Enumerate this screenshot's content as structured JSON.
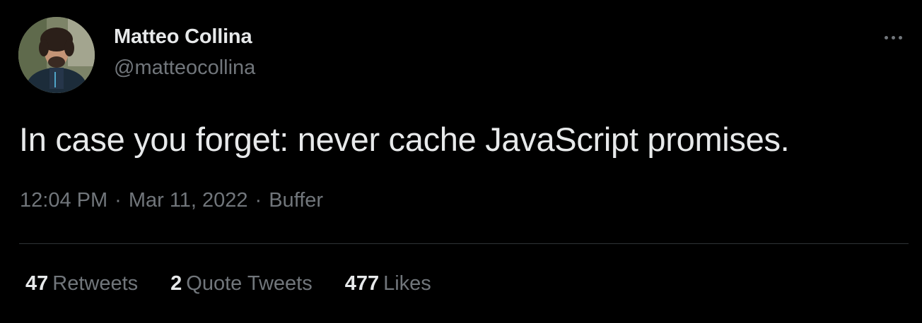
{
  "author": {
    "display_name": "Matteo Collina",
    "handle": "@matteocollina"
  },
  "tweet": {
    "text": "In case you forget: never cache JavaScript promises.",
    "time": "12:04 PM",
    "date": "Mar 11, 2022",
    "source": "Buffer",
    "separator": "·"
  },
  "stats": {
    "retweets_count": "47",
    "retweets_label": "Retweets",
    "quotes_count": "2",
    "quotes_label": "Quote Tweets",
    "likes_count": "477",
    "likes_label": "Likes"
  },
  "icons": {
    "more": "more-horizontal-icon"
  },
  "colors": {
    "background": "#000000",
    "primary_text": "#e7e9ea",
    "secondary_text": "#71767b",
    "divider": "#2f3336"
  }
}
